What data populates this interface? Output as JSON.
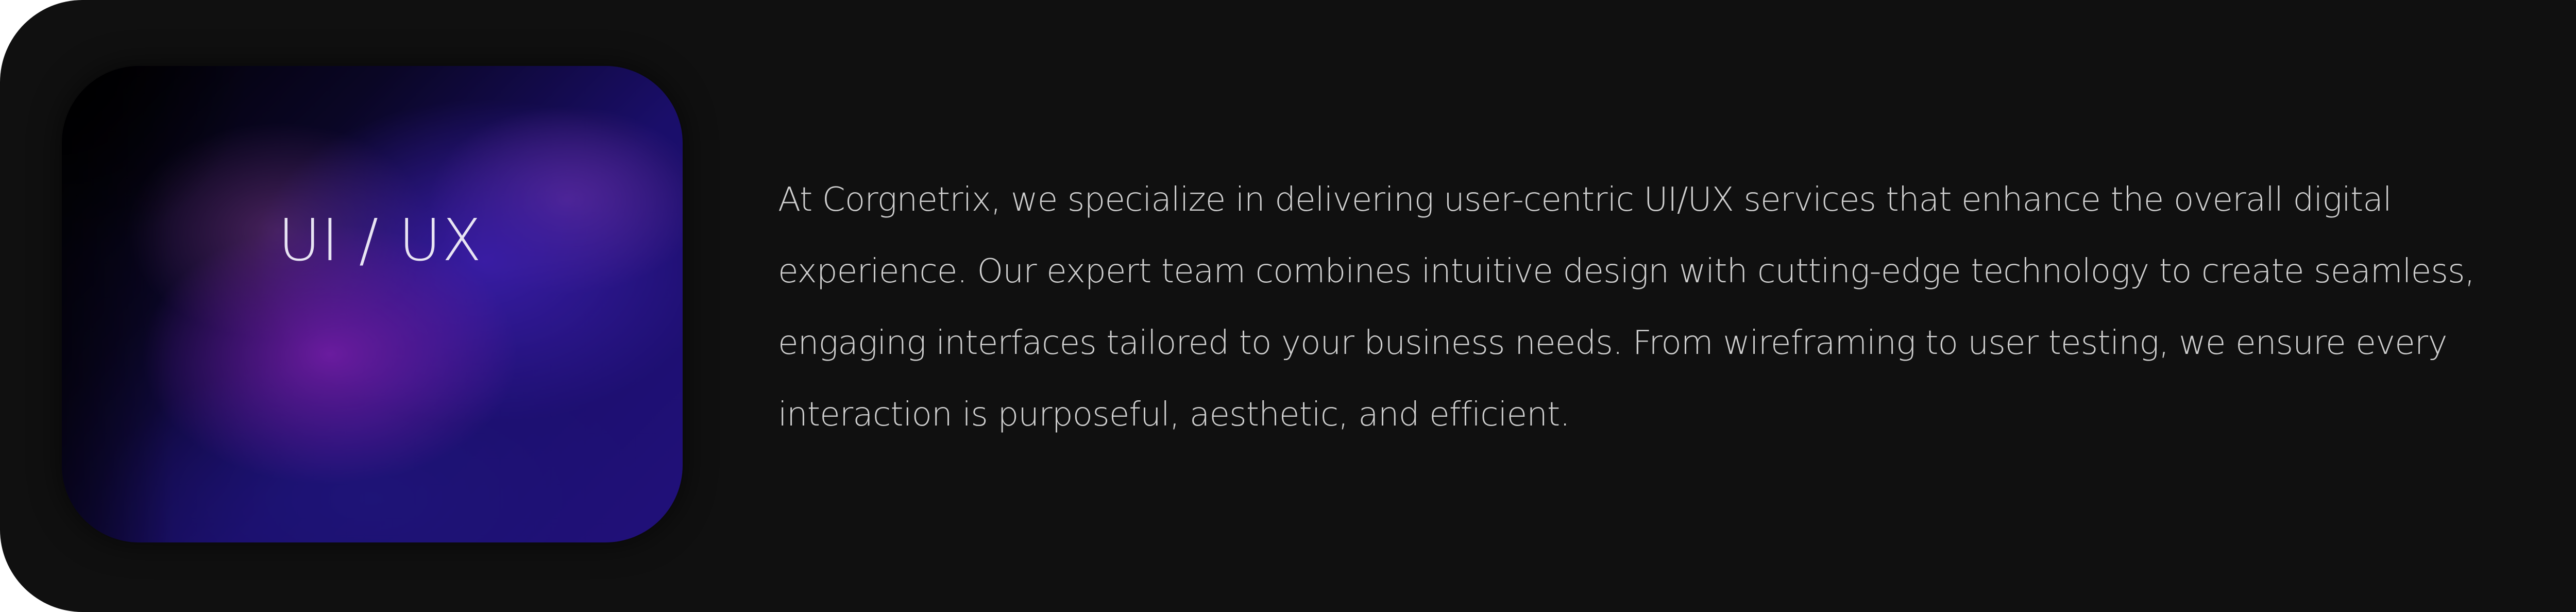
{
  "service_card": {
    "title": "UI / UX",
    "description": "At Corgnetrix, we specialize in delivering user-centric UI/UX services that enhance the overall digital experience. Our expert team combines intuitive design with cutting-edge technology to create seamless, engaging interfaces tailored to your business needs. From wireframing to user testing, we ensure every interaction is purposeful, aesthetic, and efficient."
  },
  "colors": {
    "card_background": "#101010",
    "text": "#cfcfcf",
    "gradient_purple": "#781eaa",
    "gradient_indigo": "#21107a"
  }
}
